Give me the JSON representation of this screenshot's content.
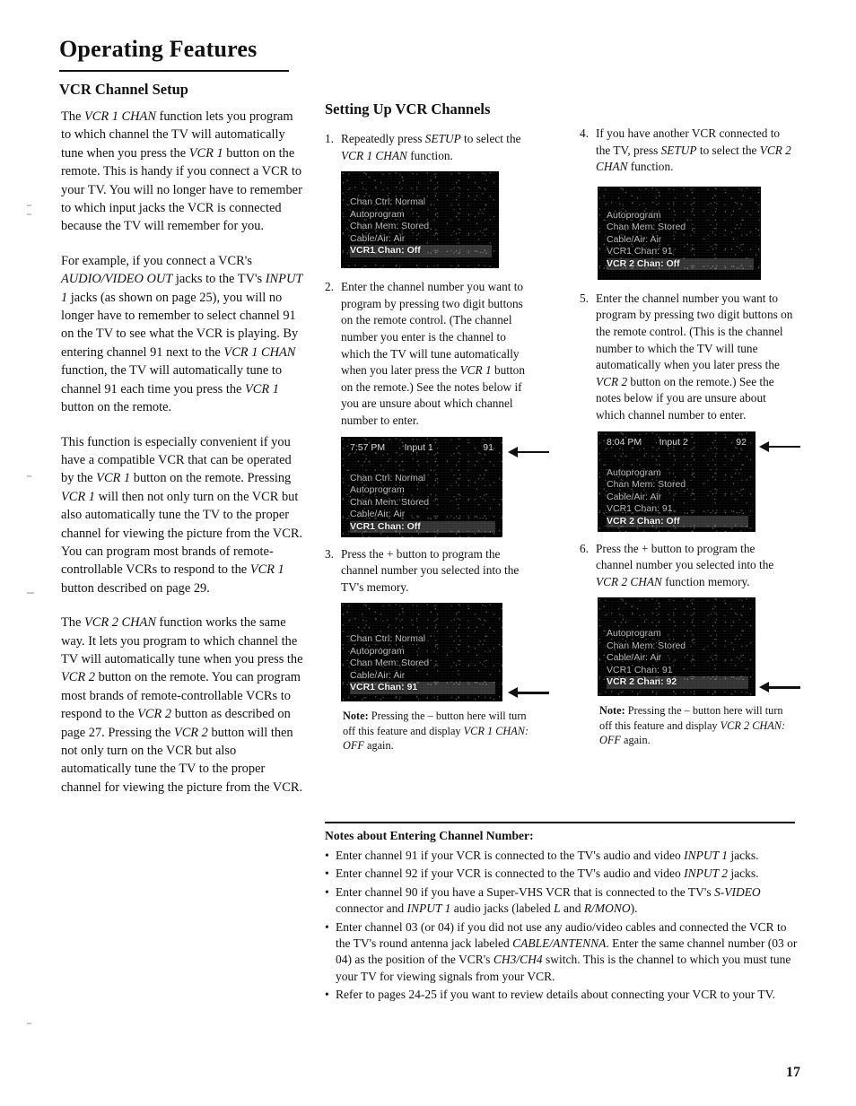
{
  "page": {
    "title": "Operating Features",
    "folio": "17"
  },
  "left": {
    "heading": "VCR Channel Setup",
    "paragraphs": [
      "The VCR 1 CHAN function lets you program to which channel the TV will automatically tune when you press the VCR 1 button on the remote.  This is handy if you connect a VCR to your TV.  You will no longer have to remember to which input jacks the VCR is connected because the TV will remember for you.",
      "For example, if you connect a VCR's AUDIO/VIDEO OUT jacks to the TV's INPUT 1 jacks (as shown on page 25), you will no longer have to remember to select channel 91 on the TV to see what the VCR is playing.  By entering channel 91 next to the VCR 1 CHAN function, the TV will automatically tune to channel 91 each time you press the VCR 1 button on the remote.",
      "This function is especially convenient if you have a compatible VCR that can be operated by the VCR 1 button on the remote.  Pressing VCR 1 will then not only turn on the VCR but also automatically tune the TV to the proper channel for viewing the picture from the VCR.  You can program most brands of remote-controllable VCRs to respond to the VCR 1 button described on page 29.",
      "The VCR 2 CHAN function works the same way.  It lets you program to which channel the TV will automatically tune when you press the VCR 2 button on the remote.  You can program most brands of remote-controllable VCRs to respond to the VCR 2 button as described on page 27.  Pressing the VCR 2 button will then not only turn on the VCR but also automatically tune the TV to the proper channel for viewing the picture from the VCR."
    ]
  },
  "middle": {
    "heading": "Setting Up VCR Channels",
    "steps": [
      {
        "num": "1.",
        "text": "Repeatedly press SETUP to select the VCR 1 CHAN function."
      },
      {
        "num": "2.",
        "text": "Enter the channel number you want to program by pressing two digit buttons on the remote control.  (The channel number you enter is the channel to which the TV will tune automatically when you later press the VCR 1 button on the remote.)  See the notes below if you are unsure about which channel number to enter."
      },
      {
        "num": "3.",
        "text": "Press the + button to program the channel number you selected into the TV's memory."
      }
    ],
    "screens": [
      {
        "id": "screen-step1",
        "top_left": "",
        "top_mid": "",
        "top_right": "",
        "lines": [
          {
            "text": "Chan Ctrl: Normal",
            "highlight": false
          },
          {
            "text": "Autoprogram",
            "highlight": false
          },
          {
            "text": "Chan Mem: Stored",
            "highlight": false
          },
          {
            "text": "Cable/Air: Air",
            "highlight": false
          },
          {
            "text": "VCR1 Chan: Off",
            "highlight": true
          }
        ]
      },
      {
        "id": "screen-step2",
        "top_left": "7:57 PM",
        "top_mid": "Input 1",
        "top_right": "91",
        "lines": [
          {
            "text": "Chan Ctrl: Normal",
            "highlight": false
          },
          {
            "text": "Autoprogram",
            "highlight": false
          },
          {
            "text": "Chan Mem: Stored",
            "highlight": false
          },
          {
            "text": "Cable/Air: Air",
            "highlight": false
          },
          {
            "text": "VCR1 Chan: Off",
            "highlight": true
          }
        ]
      },
      {
        "id": "screen-step3",
        "top_left": "",
        "top_mid": "",
        "top_right": "",
        "lines": [
          {
            "text": "Chan Ctrl: Normal",
            "highlight": false
          },
          {
            "text": "Autoprogram",
            "highlight": false
          },
          {
            "text": "Chan Mem: Stored",
            "highlight": false
          },
          {
            "text": "Cable/Air: Air",
            "highlight": false
          },
          {
            "text": "VCR1 Chan: 91",
            "highlight": true
          }
        ]
      }
    ],
    "note": {
      "label": "Note:",
      "text": " Pressing the – button here will turn off this feature and display ",
      "italic": "VCR 1 CHAN: OFF",
      "tail": " again."
    }
  },
  "right": {
    "steps": [
      {
        "num": "4.",
        "text": "If you have another VCR connected to the TV, press SETUP to select the VCR 2 CHAN function."
      },
      {
        "num": "5.",
        "text": "Enter the channel number you want to program by pressing two digit buttons on the remote control.  (This is the channel number to which the TV will tune automatically when you later press the VCR 2 button on the remote.)  See the notes below if you are unsure about which channel number to enter."
      },
      {
        "num": "6.",
        "text": "Press the + button to program the channel number you selected into the VCR 2 CHAN function memory."
      }
    ],
    "screens": [
      {
        "id": "screen-step4",
        "top_left": "",
        "top_mid": "",
        "top_right": "",
        "lines": [
          {
            "text": "Autoprogram",
            "highlight": false
          },
          {
            "text": "Chan Mem: Stored",
            "highlight": false
          },
          {
            "text": "Cable/Air: Air",
            "highlight": false
          },
          {
            "text": "VCR1 Chan: 91",
            "highlight": false
          },
          {
            "text": "VCR 2 Chan: Off",
            "highlight": true
          }
        ]
      },
      {
        "id": "screen-step5",
        "top_left": "8:04 PM",
        "top_mid": "Input 2",
        "top_right": "92",
        "lines": [
          {
            "text": "Autoprogram",
            "highlight": false
          },
          {
            "text": "Chan Mem: Stored",
            "highlight": false
          },
          {
            "text": "Cable/Air: Air",
            "highlight": false
          },
          {
            "text": "VCR1 Chan: 91",
            "highlight": false
          },
          {
            "text": "VCR 2 Chan: Off",
            "highlight": true
          }
        ]
      },
      {
        "id": "screen-step6",
        "top_left": "",
        "top_mid": "",
        "top_right": "",
        "lines": [
          {
            "text": "Autoprogram",
            "highlight": false
          },
          {
            "text": "Chan Mem: Stored",
            "highlight": false
          },
          {
            "text": "Cable/Air: Air",
            "highlight": false
          },
          {
            "text": "VCR1 Chan: 91",
            "highlight": false
          },
          {
            "text": "VCR 2 Chan: 92",
            "highlight": true
          }
        ]
      }
    ],
    "note": {
      "label": "Note:",
      "text": " Pressing the – button here will turn off this feature and display ",
      "italic": "VCR 2 CHAN: OFF",
      "tail": " again."
    }
  },
  "notes": {
    "title": "Notes about Entering Channel Number:",
    "bullets": [
      "Enter channel 91 if your VCR is connected to the TV's audio and video INPUT 1 jacks.",
      "Enter channel 92 if your VCR is connected to the TV's audio and video INPUT 2 jacks.",
      "Enter channel 90 if you have a Super-VHS VCR that is connected to the TV's S-VIDEO connector and INPUT 1 audio jacks (labeled L and R/MONO).",
      "Enter channel 03 (or 04) if you did not use any audio/video cables and connected the VCR to the TV's round antenna jack labeled CABLE/ANTENNA.  Enter the same channel number (03 or 04) as the position of the VCR's CH3/CH4 switch.  This is the channel to which you must tune your TV for viewing signals from your VCR.",
      "Refer to pages 24-25 if you want to review details about connecting your VCR to your TV."
    ]
  }
}
